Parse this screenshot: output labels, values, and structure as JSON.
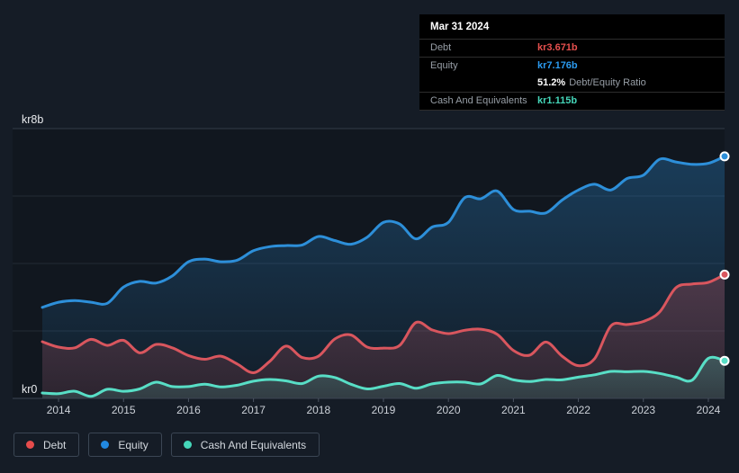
{
  "tooltip": {
    "date": "Mar 31 2024",
    "debt_label": "Debt",
    "debt_value": "kr3.671b",
    "debt_color": "#e6504e",
    "equity_label": "Equity",
    "equity_value": "kr7.176b",
    "equity_color": "#2b9af0",
    "ratio_value": "51.2%",
    "ratio_label": "Debt/Equity Ratio",
    "cash_label": "Cash And Equivalents",
    "cash_value": "kr1.115b",
    "cash_color": "#45d6b9"
  },
  "legend": {
    "items": [
      {
        "label": "Debt",
        "color": "#e64c4c"
      },
      {
        "label": "Equity",
        "color": "#2188e0"
      },
      {
        "label": "Cash And Equivalents",
        "color": "#45d6b9"
      }
    ]
  },
  "chart_data": {
    "type": "area",
    "x_unit": "decimal_year",
    "x_range": [
      2013.75,
      2024.25
    ],
    "x_ticks": [
      2014,
      2015,
      2016,
      2017,
      2018,
      2019,
      2020,
      2021,
      2022,
      2023,
      2024
    ],
    "y_axis": {
      "min": 0,
      "max": 8,
      "min_label": "kr0",
      "max_label": "kr8b",
      "gridline_values": [
        8,
        6,
        4,
        2
      ]
    },
    "legend_position": "bottom-left",
    "grid": true,
    "currency": "kr (billions)",
    "x": [
      2013.75,
      2014.0,
      2014.25,
      2014.5,
      2014.75,
      2015.0,
      2015.25,
      2015.5,
      2015.75,
      2016.0,
      2016.25,
      2016.5,
      2016.75,
      2017.0,
      2017.25,
      2017.5,
      2017.75,
      2018.0,
      2018.25,
      2018.5,
      2018.75,
      2019.0,
      2019.25,
      2019.5,
      2019.75,
      2020.0,
      2020.25,
      2020.5,
      2020.75,
      2021.0,
      2021.25,
      2021.5,
      2021.75,
      2022.0,
      2022.25,
      2022.5,
      2022.75,
      2023.0,
      2023.25,
      2023.5,
      2023.75,
      2024.0,
      2024.25
    ],
    "series": [
      {
        "name": "Equity",
        "color": "#2d8fd9",
        "values": [
          2.7,
          2.85,
          2.9,
          2.85,
          2.82,
          3.3,
          3.47,
          3.42,
          3.63,
          4.05,
          4.13,
          4.05,
          4.1,
          4.38,
          4.5,
          4.53,
          4.55,
          4.8,
          4.68,
          4.57,
          4.78,
          5.22,
          5.17,
          4.73,
          5.08,
          5.22,
          5.95,
          5.92,
          6.15,
          5.6,
          5.55,
          5.5,
          5.88,
          6.18,
          6.35,
          6.18,
          6.52,
          6.62,
          7.09,
          7.01,
          6.94,
          6.97,
          7.176
        ]
      },
      {
        "name": "Debt",
        "color": "#d9565e",
        "values": [
          1.68,
          1.52,
          1.5,
          1.75,
          1.57,
          1.72,
          1.35,
          1.6,
          1.5,
          1.27,
          1.16,
          1.25,
          1.02,
          0.76,
          1.1,
          1.55,
          1.21,
          1.25,
          1.76,
          1.88,
          1.52,
          1.49,
          1.57,
          2.25,
          2.03,
          1.92,
          2.02,
          2.05,
          1.9,
          1.42,
          1.28,
          1.67,
          1.25,
          0.97,
          1.18,
          2.15,
          2.19,
          2.28,
          2.56,
          3.28,
          3.39,
          3.44,
          3.671
        ]
      },
      {
        "name": "Cash And Equivalents",
        "color": "#58dec6",
        "values": [
          0.16,
          0.14,
          0.21,
          0.06,
          0.27,
          0.21,
          0.28,
          0.48,
          0.35,
          0.35,
          0.42,
          0.34,
          0.39,
          0.51,
          0.56,
          0.52,
          0.44,
          0.66,
          0.62,
          0.42,
          0.28,
          0.36,
          0.44,
          0.3,
          0.43,
          0.48,
          0.48,
          0.43,
          0.68,
          0.55,
          0.5,
          0.56,
          0.55,
          0.63,
          0.7,
          0.8,
          0.79,
          0.8,
          0.74,
          0.63,
          0.54,
          1.19,
          1.115
        ]
      }
    ],
    "final_values": {
      "equity_b": 7.176,
      "debt_b": 3.671,
      "cash_b": 1.115,
      "debt_equity_ratio_pct": 51.2
    }
  }
}
